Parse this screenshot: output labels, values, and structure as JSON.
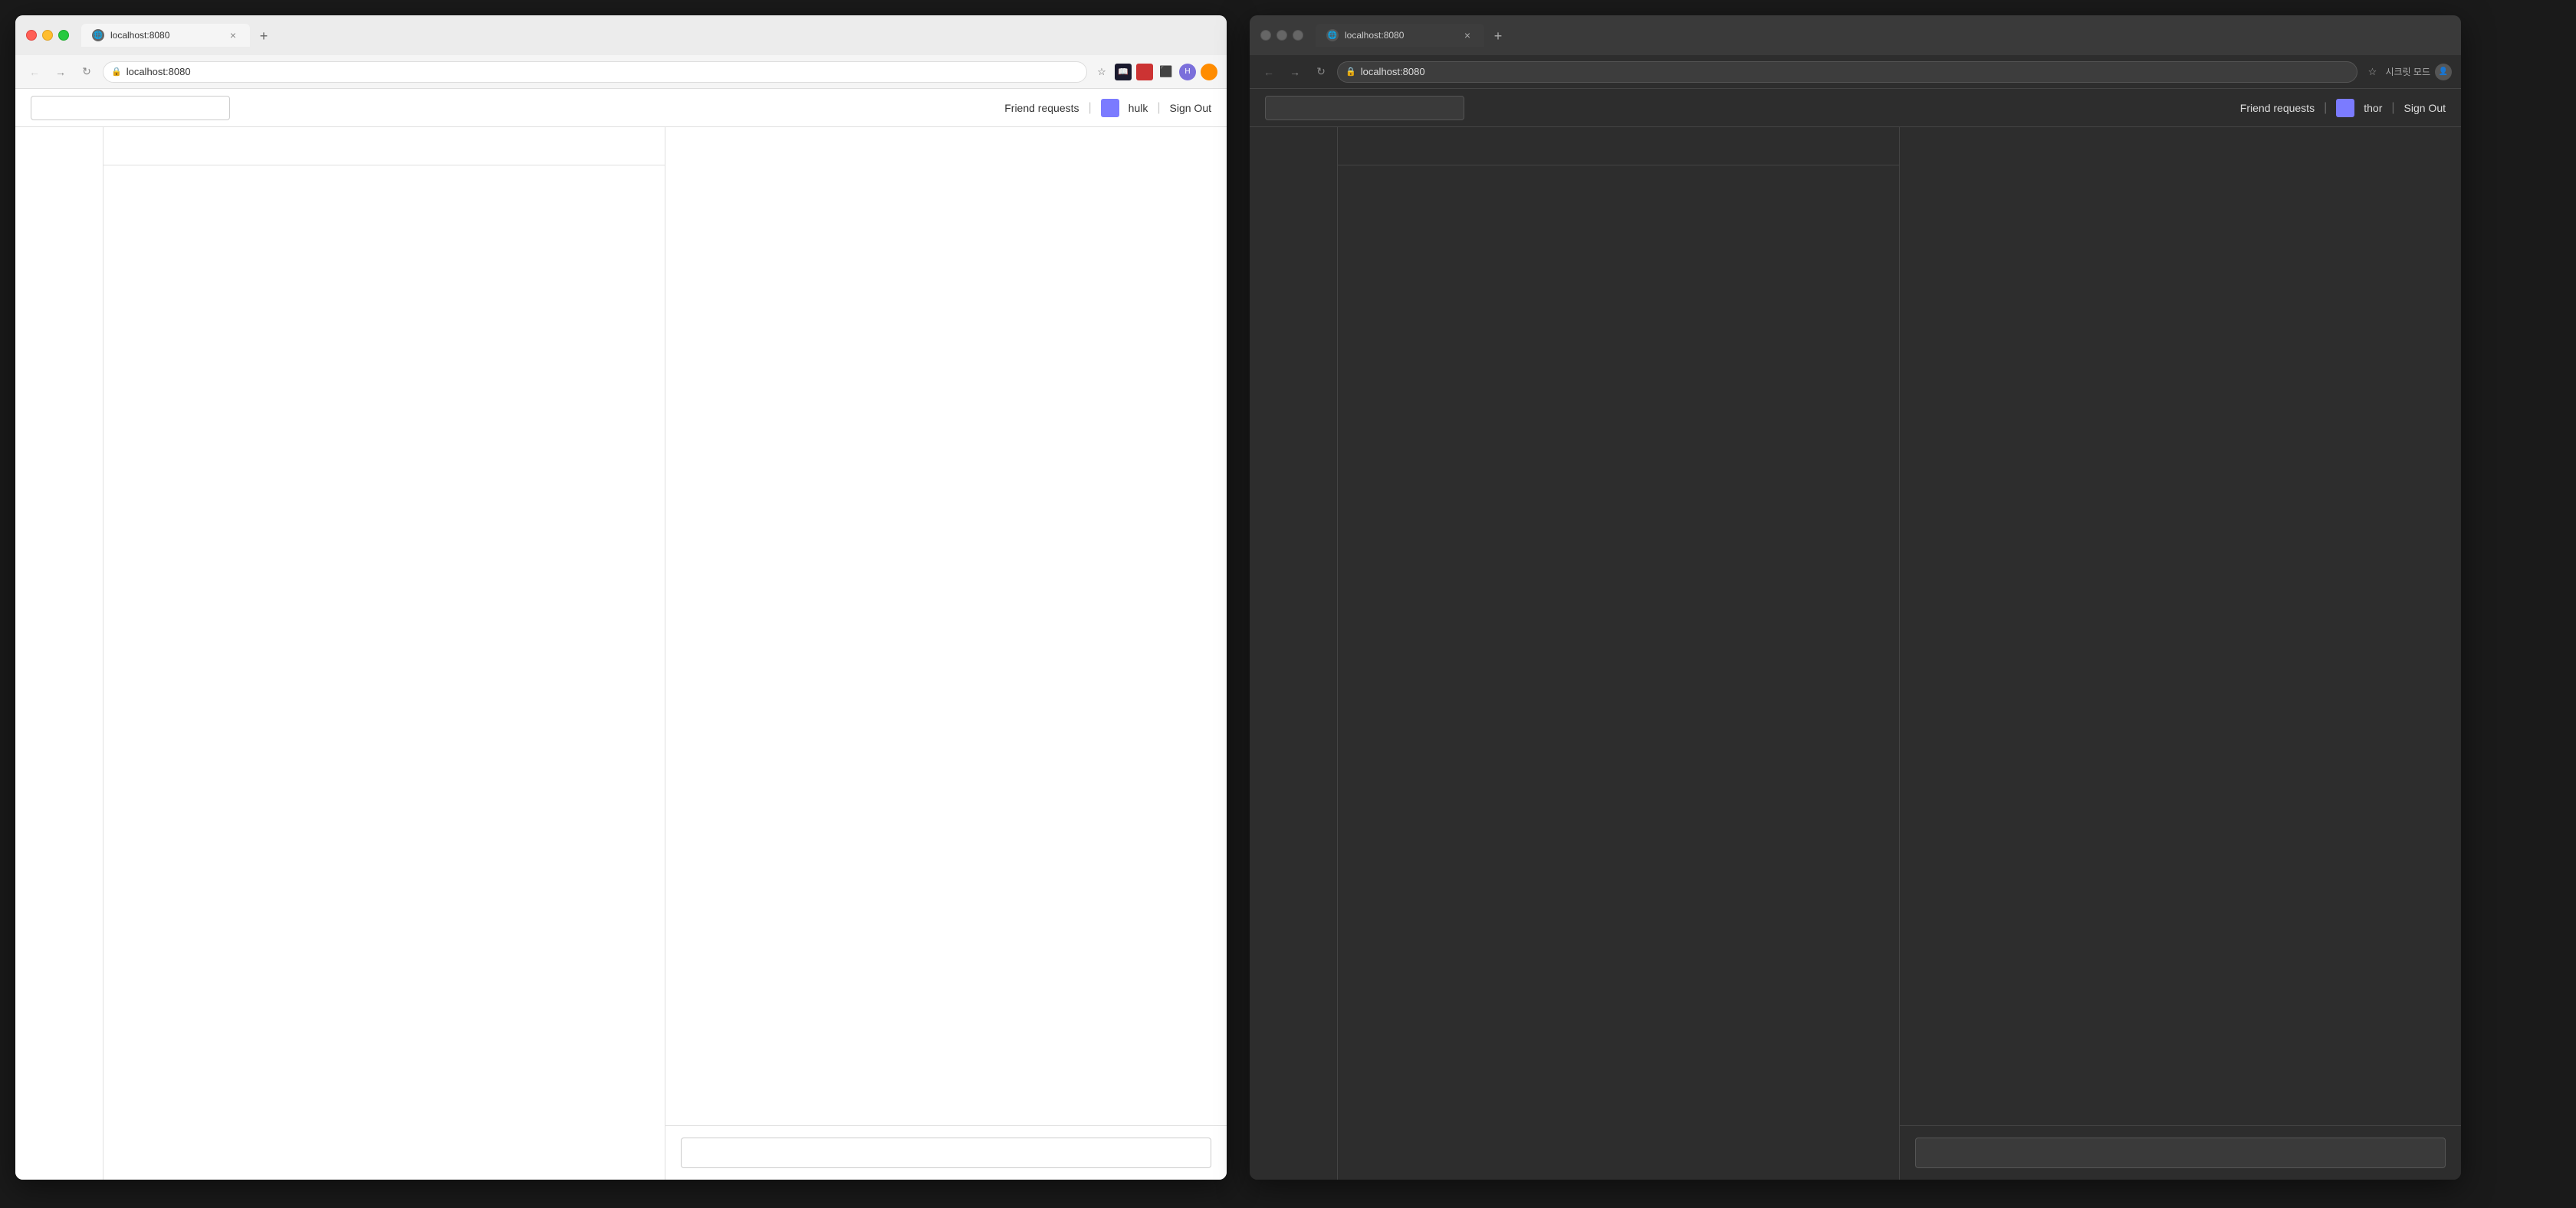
{
  "browser_left": {
    "theme": "light",
    "title_bar": {
      "traffic_lights": [
        "red",
        "yellow",
        "green"
      ]
    },
    "tab": {
      "url": "localhost:8080",
      "title": "localhost:8080"
    },
    "nav": {
      "url": "localhost:8080"
    },
    "app": {
      "search_placeholder": "",
      "nav_items": {
        "friend_requests": "Friend requests",
        "separator": "|",
        "username": "hulk",
        "separator2": "|",
        "sign_out": "Sign Out"
      }
    },
    "chat": {
      "input_placeholder": ""
    }
  },
  "browser_right": {
    "theme": "dark",
    "title_bar": {
      "traffic_lights": [
        "gray",
        "gray",
        "gray"
      ]
    },
    "tab": {
      "url": "localhost:8080",
      "title": "localhost:8080"
    },
    "nav": {
      "url": "localhost:8080",
      "secret_mode_label": "시크릿 모드"
    },
    "app": {
      "search_placeholder": "",
      "nav_items": {
        "friend_requests": "Friend requests",
        "separator": "|",
        "username": "thor",
        "separator2": "|",
        "sign_out": "Sign Out"
      }
    },
    "chat": {
      "input_placeholder": ""
    }
  }
}
